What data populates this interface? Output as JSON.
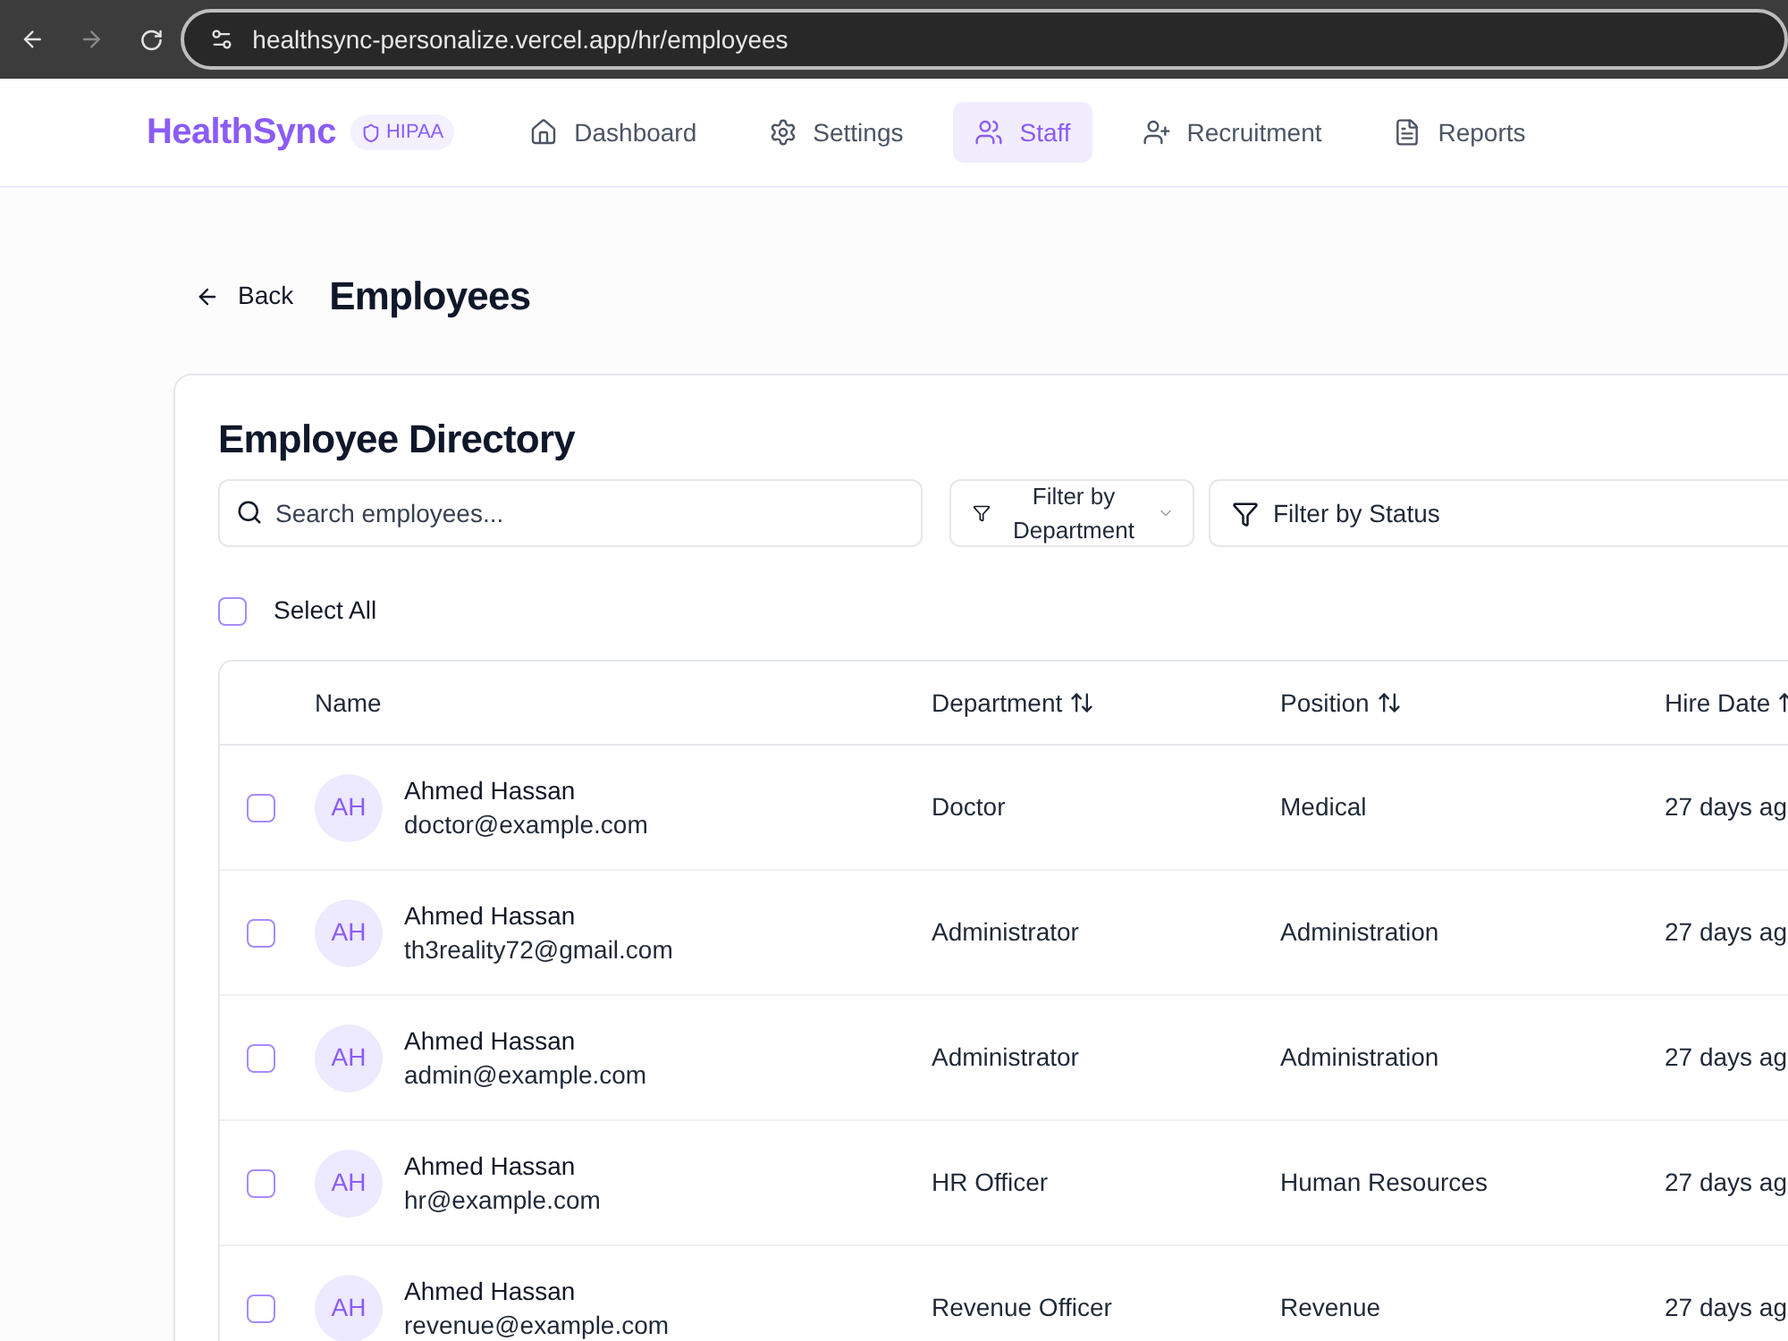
{
  "browser": {
    "url": "healthsync-personalize.vercel.app/hr/employees"
  },
  "header": {
    "logo": "HealthSync",
    "badge": "HIPAA",
    "nav": [
      {
        "label": "Dashboard",
        "selected": false
      },
      {
        "label": "Settings",
        "selected": false
      },
      {
        "label": "Staff",
        "selected": true
      },
      {
        "label": "Recruitment",
        "selected": false
      },
      {
        "label": "Reports",
        "selected": false
      }
    ]
  },
  "page": {
    "back": "Back",
    "title": "Employees"
  },
  "directory": {
    "title": "Employee Directory",
    "search": {
      "placeholder": "Search employees..."
    },
    "filters": [
      {
        "label": "Filter by Department",
        "kind": "dropdown"
      },
      {
        "label": "Filter by Status",
        "kind": "select"
      }
    ],
    "select_all": {
      "label": "Select All",
      "checked": false
    },
    "table": {
      "columns": [
        {
          "label": "Name",
          "sortable": false
        },
        {
          "label": "Department",
          "sortable": true
        },
        {
          "label": "Position",
          "sortable": true
        },
        {
          "label": "Hire Date",
          "sortable": true
        }
      ],
      "rows": [
        {
          "initials": "AH",
          "name": "Ahmed Hassan",
          "email": "doctor@example.com",
          "department": "Doctor",
          "position": "Medical",
          "hire_date": "27 days ag",
          "checked": false
        },
        {
          "initials": "AH",
          "name": "Ahmed Hassan",
          "email": "th3reality72@gmail.com",
          "department": "Administrator",
          "position": "Administration",
          "hire_date": "27 days ag",
          "checked": false
        },
        {
          "initials": "AH",
          "name": "Ahmed Hassan",
          "email": "admin@example.com",
          "department": "Administrator",
          "position": "Administration",
          "hire_date": "27 days ag",
          "checked": false
        },
        {
          "initials": "AH",
          "name": "Ahmed Hassan",
          "email": "hr@example.com",
          "department": "HR Officer",
          "position": "Human Resources",
          "hire_date": "27 days ag",
          "checked": false
        },
        {
          "initials": "AH",
          "name": "Ahmed Hassan",
          "email": "revenue@example.com",
          "department": "Revenue Officer",
          "position": "Revenue",
          "hire_date": "27 days ag",
          "checked": false
        }
      ]
    }
  }
}
